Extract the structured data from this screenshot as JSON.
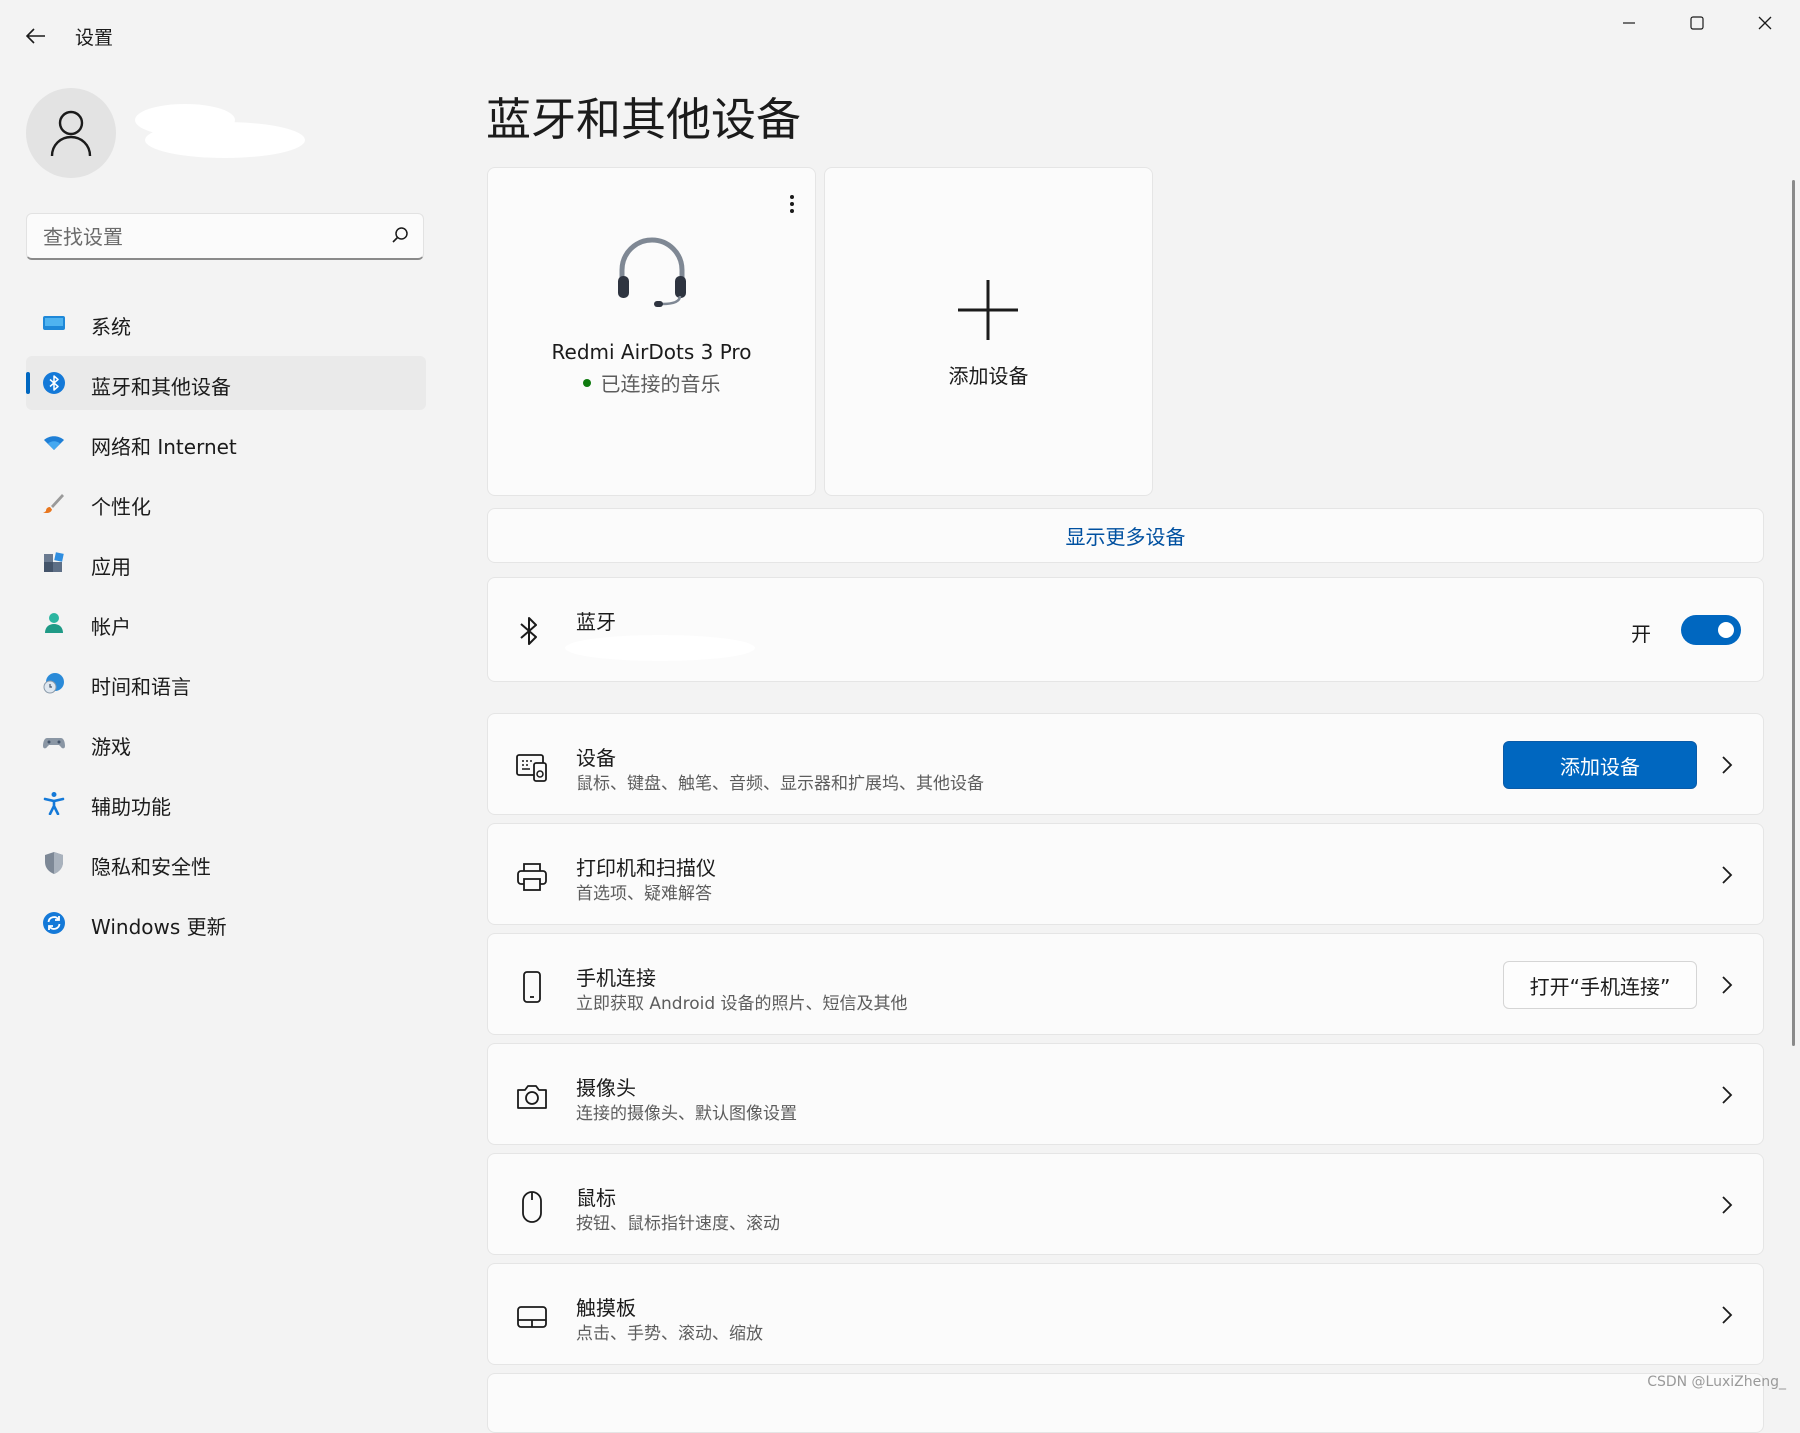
{
  "window": {
    "title": "设置",
    "controls": [
      "minimize",
      "maximize",
      "close"
    ]
  },
  "search": {
    "placeholder": "查找设置"
  },
  "sidebar": {
    "items": [
      {
        "label": "系统",
        "icon": "monitor-icon"
      },
      {
        "label": "蓝牙和其他设备",
        "icon": "bluetooth-icon",
        "active": true
      },
      {
        "label": "网络和 Internet",
        "icon": "wifi-icon"
      },
      {
        "label": "个性化",
        "icon": "paintbrush-icon"
      },
      {
        "label": "应用",
        "icon": "apps-icon"
      },
      {
        "label": "帐户",
        "icon": "account-icon"
      },
      {
        "label": "时间和语言",
        "icon": "globe-clock-icon"
      },
      {
        "label": "游戏",
        "icon": "gamepad-icon"
      },
      {
        "label": "辅助功能",
        "icon": "accessibility-icon"
      },
      {
        "label": "隐私和安全性",
        "icon": "shield-icon"
      },
      {
        "label": "Windows 更新",
        "icon": "update-icon"
      }
    ]
  },
  "main": {
    "title": "蓝牙和其他设备",
    "device_card": {
      "name": "Redmi AirDots 3 Pro",
      "status": "已连接的音乐"
    },
    "add_device_card": {
      "label": "添加设备"
    },
    "show_more": "显示更多设备",
    "bluetooth": {
      "title": "蓝牙",
      "state_label": "开",
      "enabled": true
    },
    "rows": [
      {
        "title": "设备",
        "subtitle": "鼠标、键盘、触笔、音频、显示器和扩展坞、其他设备",
        "icon": "devices-icon",
        "button": "添加设备"
      },
      {
        "title": "打印机和扫描仪",
        "subtitle": "首选项、疑难解答",
        "icon": "printer-icon"
      },
      {
        "title": "手机连接",
        "subtitle": "立即获取 Android 设备的照片、短信及其他",
        "icon": "phone-icon",
        "button": "打开“手机连接”"
      },
      {
        "title": "摄像头",
        "subtitle": "连接的摄像头、默认图像设置",
        "icon": "camera-icon"
      },
      {
        "title": "鼠标",
        "subtitle": "按钮、鼠标指针速度、滚动",
        "icon": "mouse-icon"
      },
      {
        "title": "触摸板",
        "subtitle": "点击、手势、滚动、缩放",
        "icon": "touchpad-icon"
      }
    ]
  },
  "watermark": "CSDN @LuxiZheng_",
  "colors": {
    "accent": "#0067c0",
    "background": "#f3f3f3",
    "card": "#fbfbfb",
    "link": "#0050a0",
    "status_connected": "#0f7b0f"
  }
}
